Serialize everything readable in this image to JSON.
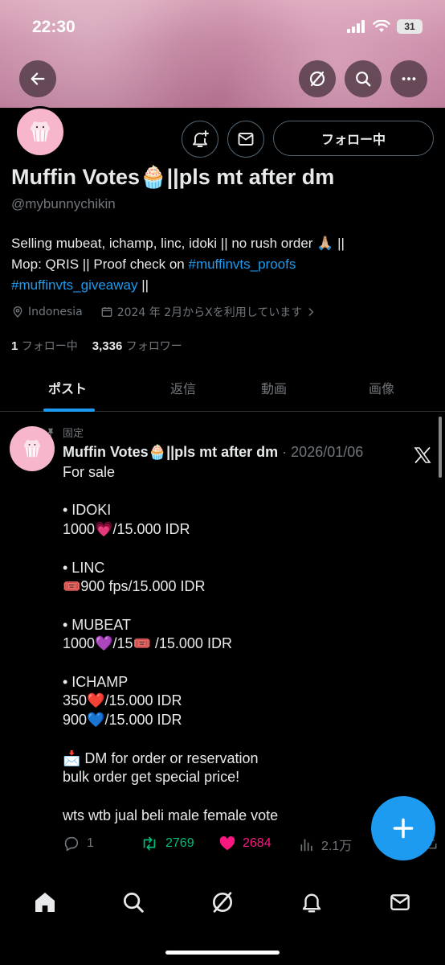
{
  "status_bar": {
    "time": "22:30",
    "battery": "31"
  },
  "profile": {
    "name": "Muffin Votes🧁||pls mt after dm",
    "handle": "@mybunnychikin",
    "follow_button_label": "フォロー中",
    "bio_line1": "Selling mubeat, ichamp, linc, idoki || no rush order 🙏🏼 ||",
    "bio_line2_prefix": "Mop: QRIS || Proof check on ",
    "bio_tag1": "#muffinvts_proofs",
    "bio_tag2": "#muffinvts_giveaway",
    "bio_suffix": " ||",
    "location": "Indonesia",
    "joined": "2024 年 2月からXを利用しています",
    "following_count": "1",
    "following_label": "フォロー中",
    "followers_count": "3,336",
    "followers_label": "フォロワー"
  },
  "tabs": [
    {
      "label": "ポスト",
      "active": true
    },
    {
      "label": "返信",
      "active": false
    },
    {
      "label": "動画",
      "active": false
    },
    {
      "label": "画像",
      "active": false
    }
  ],
  "post": {
    "pinned_label": "固定",
    "author": "Muffin Votes🧁||pls mt after dm",
    "date": " · 2026/01/06",
    "body": "For sale\n\n• IDOKI\n1000💗/15.000 IDR\n\n• LINC\n🎟️900 fps/15.000 IDR\n\n• MUBEAT\n1000💜/15🎟️ /15.000 IDR\n\n• ICHAMP\n350❤️/15.000 IDR\n900💙/15.000 IDR\n\n📩 DM for order or reservation\nbulk order get special price!\n\nwts wtb jual beli male female vote",
    "replies": "1",
    "reposts": "2769",
    "likes": "2684",
    "views": "2.1万"
  },
  "icons": {
    "back": "back-arrow-icon",
    "grok": "grok-icon",
    "search": "search-icon",
    "more": "more-icon",
    "notify": "notification-bell-icon",
    "message": "mail-icon",
    "x": "x-logo-icon"
  },
  "colors": {
    "accent": "#1d9bf0",
    "repost": "#00ba7c",
    "like": "#f91880",
    "muted": "#71767b"
  }
}
